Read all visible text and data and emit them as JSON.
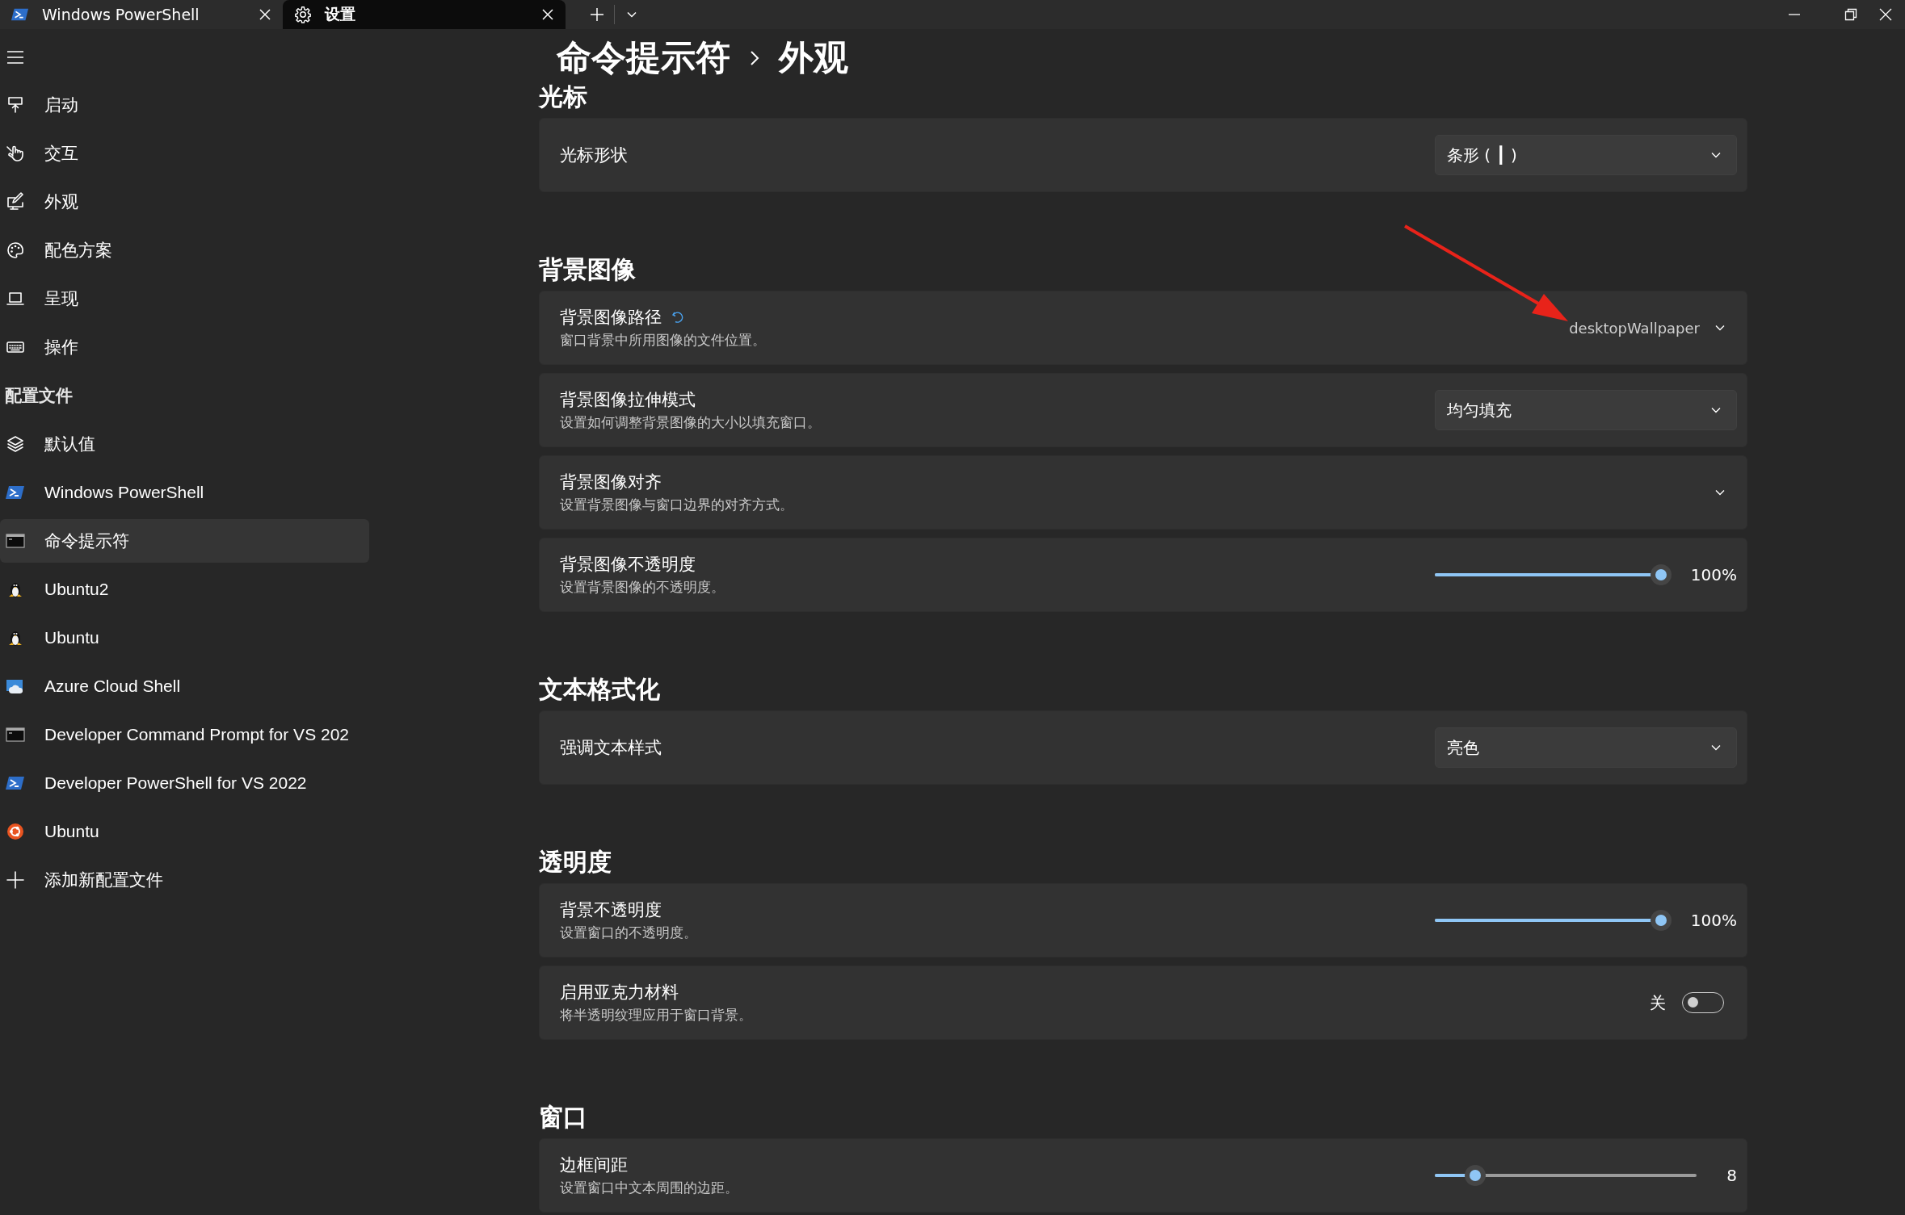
{
  "tabs": [
    {
      "title": "Windows PowerShell",
      "selected": false
    },
    {
      "title": "设置",
      "selected": true
    }
  ],
  "sidebar": {
    "groups": [
      {
        "items": [
          {
            "label": "启动",
            "selected": false
          },
          {
            "label": "交互",
            "selected": false
          },
          {
            "label": "外观",
            "selected": false
          },
          {
            "label": "配色方案",
            "selected": false
          },
          {
            "label": "呈现",
            "selected": false
          },
          {
            "label": "操作",
            "selected": false
          }
        ]
      },
      {
        "title": "配置文件",
        "items": [
          {
            "label": "默认值",
            "selected": false
          },
          {
            "label": "Windows PowerShell",
            "selected": false
          },
          {
            "label": "命令提示符",
            "selected": true
          },
          {
            "label": "Ubuntu2",
            "selected": false
          },
          {
            "label": "Ubuntu",
            "selected": false
          },
          {
            "label": "Azure Cloud Shell",
            "selected": false
          },
          {
            "label": "Developer Command Prompt for VS 202",
            "selected": false
          },
          {
            "label": "Developer PowerShell for VS 2022",
            "selected": false
          },
          {
            "label": "Ubuntu",
            "selected": false
          },
          {
            "label": "添加新配置文件",
            "selected": false
          }
        ]
      }
    ]
  },
  "breadcrumb": [
    "命令提示符",
    "外观"
  ],
  "sections": [
    {
      "title": "光标",
      "settings": [
        {
          "kind": "dropdown",
          "label": "光标形状",
          "value": "条形 ( ┃ )"
        }
      ]
    },
    {
      "title": "背景图像",
      "settings": [
        {
          "kind": "path",
          "label": "背景图像路径",
          "modified": true,
          "description": "窗口背景中所用图像的文件位置。",
          "value": "desktopWallpaper"
        },
        {
          "kind": "dropdown",
          "label": "背景图像拉伸模式",
          "description": "设置如何调整背景图像的大小以填充窗口。",
          "value": "均匀填充"
        },
        {
          "kind": "expander",
          "label": "背景图像对齐",
          "description": "设置背景图像与窗口边界的对齐方式。"
        },
        {
          "kind": "slider",
          "label": "背景图像不透明度",
          "description": "设置背景图像的不透明度。",
          "level": 1,
          "reading": "100%"
        }
      ]
    },
    {
      "title": "文本格式化",
      "settings": [
        {
          "kind": "dropdown",
          "label": "强调文本样式",
          "value": "亮色"
        }
      ]
    },
    {
      "title": "透明度",
      "settings": [
        {
          "kind": "slider",
          "label": "背景不透明度",
          "description": "设置窗口的不透明度。",
          "level": 1,
          "reading": "100%"
        },
        {
          "kind": "toggle",
          "label": "启用亚克力材料",
          "description": "将半透明纹理应用于窗口背景。",
          "on": false,
          "state_label": "关"
        }
      ]
    },
    {
      "title": "窗口",
      "settings": [
        {
          "kind": "slider",
          "label": "边框间距",
          "description": "设置窗口中文本周围的边距。",
          "level": 0.12,
          "reading": "8"
        }
      ]
    }
  ]
}
